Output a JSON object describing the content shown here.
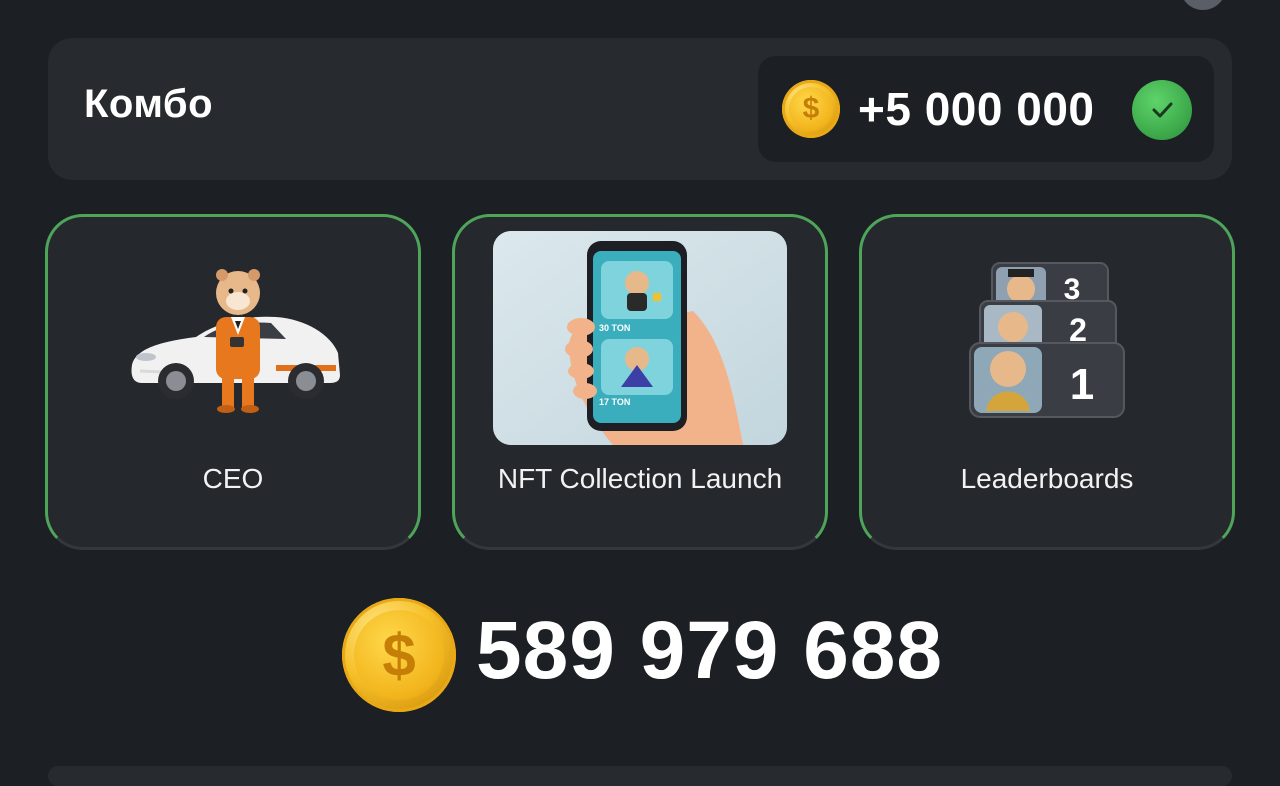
{
  "combo": {
    "title": "Комбо",
    "reward": "+5 000 000",
    "reward_icon": "coin-icon",
    "status_icon": "check-icon",
    "claimed": true
  },
  "cards": [
    {
      "label": "CEO",
      "image": "hamster-ceo-car-image"
    },
    {
      "label": "NFT Collection Launch",
      "image": "nft-phone-image"
    },
    {
      "label": "Leaderboards",
      "image": "leaderboards-image",
      "ranks": [
        "3",
        "2",
        "1"
      ]
    }
  ],
  "balance": {
    "value": "589 979 688",
    "icon": "coin-icon"
  },
  "nft_phone": {
    "item1_price": "30 TON",
    "item2_price": "17 TON"
  },
  "colors": {
    "background": "#1c1f24",
    "panel": "#272a2f",
    "card_border": "#4ea55a",
    "coin": "#f6c12a",
    "check": "#3aa548"
  }
}
